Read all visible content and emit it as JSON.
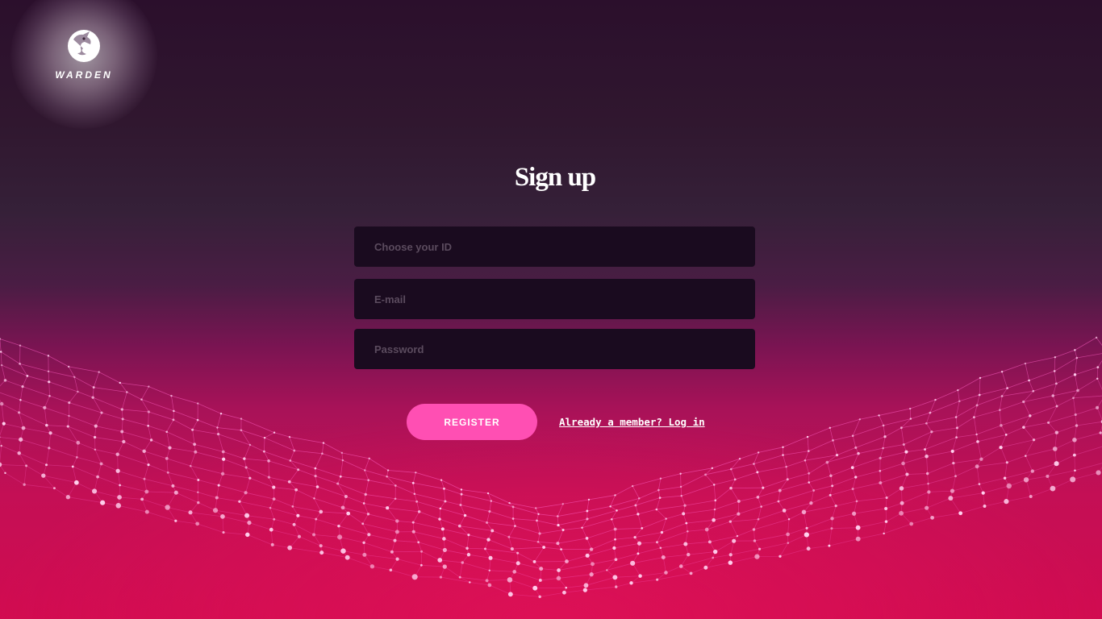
{
  "brand": {
    "name": "WARDEN",
    "logo_icon": "bird-head-icon"
  },
  "signup": {
    "title": "Sign up",
    "fields": {
      "id": {
        "placeholder": "Choose your ID",
        "value": ""
      },
      "email": {
        "placeholder": "E-mail",
        "value": ""
      },
      "password": {
        "placeholder": "Password",
        "value": ""
      }
    },
    "register_label": "REGISTER",
    "login_link_label": "Already a member? Log in"
  },
  "colors": {
    "accent": "#ff4fb3",
    "input_background": "#1a0b1f",
    "background_top": "#2b0f2c",
    "background_bottom": "#d10b50",
    "mesh": "#ff5ec4"
  }
}
